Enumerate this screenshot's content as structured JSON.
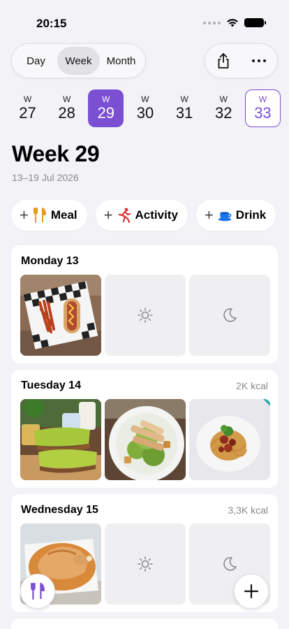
{
  "status_bar": {
    "time": "20:15"
  },
  "view_modes": {
    "day": "Day",
    "week": "Week",
    "month": "Month",
    "selected": "Week"
  },
  "toolbar": {
    "share_icon": "share-icon",
    "more_icon": "more-icon"
  },
  "week_picker": {
    "prefix": "W",
    "weeks": [
      "27",
      "28",
      "29",
      "30",
      "31",
      "32",
      "33"
    ],
    "selected": "29",
    "current": "33"
  },
  "header": {
    "title": "Week 29",
    "date_range": "13–19 Jul 2026"
  },
  "quick_add": {
    "meal": "Meal",
    "activity": "Activity",
    "drink": "Drink"
  },
  "days": [
    {
      "name": "Monday 13",
      "kcal": "",
      "tiles": [
        "photo: fries and hot dog",
        "sun-icon",
        "moon-icon"
      ]
    },
    {
      "name": "Tuesday 14",
      "kcal": "2K kcal",
      "tiles": [
        "photo: avocado toast",
        "photo: caesar salad",
        "photo: spaghetti bolognese"
      ]
    },
    {
      "name": "Wednesday 15",
      "kcal": "3,3K kcal",
      "tiles": [
        "photo: roast chicken",
        "sun-icon",
        "moon-icon"
      ]
    }
  ],
  "colors": {
    "accent": "#7a4fd1",
    "background": "#f2f2f7",
    "tile_empty": "#efeff1"
  }
}
